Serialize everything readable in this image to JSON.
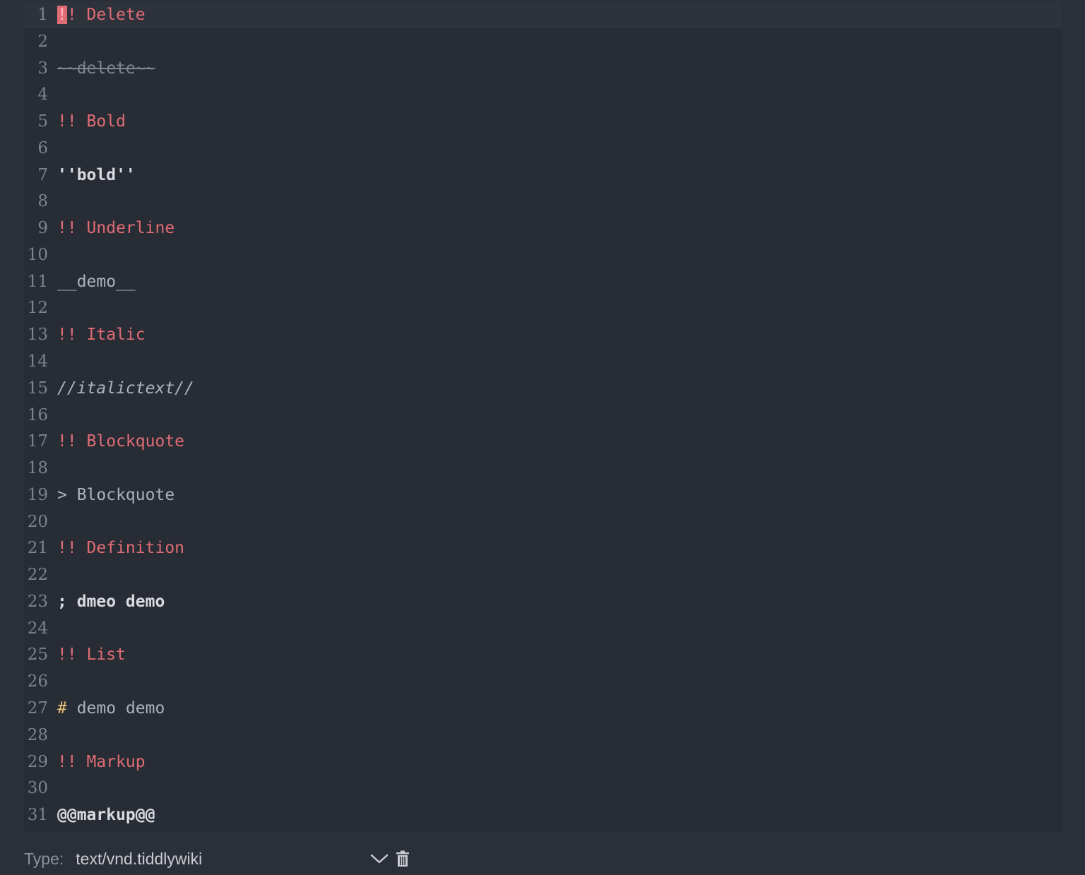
{
  "editor": {
    "lines": [
      {
        "n": "1",
        "parts": [
          {
            "t": "!",
            "c": "cursor-block"
          },
          {
            "t": "! Delete",
            "c": "heading"
          }
        ],
        "active": true
      },
      {
        "n": "2",
        "parts": []
      },
      {
        "n": "3",
        "parts": [
          {
            "t": "~~delete~~",
            "c": "strike"
          }
        ]
      },
      {
        "n": "4",
        "parts": []
      },
      {
        "n": "5",
        "parts": [
          {
            "t": "!! Bold",
            "c": "heading"
          }
        ]
      },
      {
        "n": "6",
        "parts": []
      },
      {
        "n": "7",
        "parts": [
          {
            "t": "''bold''",
            "c": "bold"
          }
        ]
      },
      {
        "n": "8",
        "parts": []
      },
      {
        "n": "9",
        "parts": [
          {
            "t": "!! Underline",
            "c": "heading"
          }
        ]
      },
      {
        "n": "10",
        "parts": []
      },
      {
        "n": "11",
        "parts": [
          {
            "t": "__demo__",
            "c": ""
          }
        ]
      },
      {
        "n": "12",
        "parts": []
      },
      {
        "n": "13",
        "parts": [
          {
            "t": "!! Italic",
            "c": "heading"
          }
        ]
      },
      {
        "n": "14",
        "parts": []
      },
      {
        "n": "15",
        "parts": [
          {
            "t": "//italictext//",
            "c": "italic"
          }
        ]
      },
      {
        "n": "16",
        "parts": []
      },
      {
        "n": "17",
        "parts": [
          {
            "t": "!! Blockquote",
            "c": "heading"
          }
        ]
      },
      {
        "n": "18",
        "parts": []
      },
      {
        "n": "19",
        "parts": [
          {
            "t": "> Blockquote",
            "c": ""
          }
        ]
      },
      {
        "n": "20",
        "parts": []
      },
      {
        "n": "21",
        "parts": [
          {
            "t": "!! Definition",
            "c": "heading"
          }
        ]
      },
      {
        "n": "22",
        "parts": []
      },
      {
        "n": "23",
        "parts": [
          {
            "t": "; dmeo demo",
            "c": "bold"
          }
        ]
      },
      {
        "n": "24",
        "parts": []
      },
      {
        "n": "25",
        "parts": [
          {
            "t": "!! List",
            "c": "heading"
          }
        ]
      },
      {
        "n": "26",
        "parts": []
      },
      {
        "n": "27",
        "parts": [
          {
            "t": "#",
            "c": "bullet"
          },
          {
            "t": " demo demo",
            "c": ""
          }
        ]
      },
      {
        "n": "28",
        "parts": []
      },
      {
        "n": "29",
        "parts": [
          {
            "t": "!! Markup",
            "c": "heading"
          }
        ]
      },
      {
        "n": "30",
        "parts": []
      },
      {
        "n": "31",
        "parts": [
          {
            "t": "@@markup@@",
            "c": "bold"
          }
        ]
      }
    ]
  },
  "footer": {
    "type_label": "Type:",
    "type_value": "text/vnd.tiddlywiki",
    "chevron_icon": "chevron-down-icon",
    "delete_icon": "trash-icon"
  },
  "colors": {
    "background": "#282c34",
    "heading": "#e06c75",
    "bullet": "#e5c07b",
    "gutter": "#7d838d"
  }
}
